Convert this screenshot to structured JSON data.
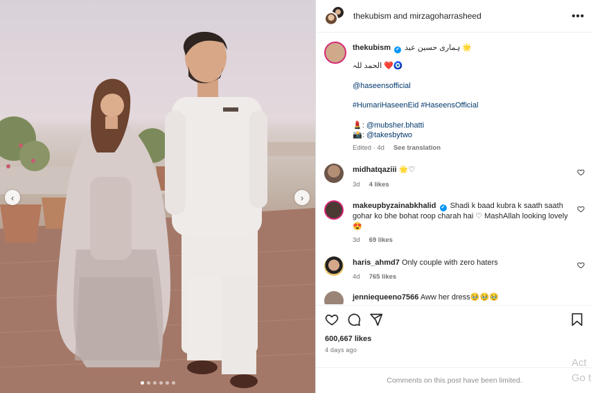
{
  "header": {
    "users": "thekubism and mirzagoharrasheed",
    "more_icon": "•••"
  },
  "caption": {
    "user": "thekubism",
    "verified_glyph": "✔",
    "line1": "ہماری حسین عید 🌟",
    "line2": "الحمد للہ ❤️🧿",
    "line3": "@haseensofficial",
    "line4": "#HumariHaseenEid #HaseensOfficial",
    "line5_prefix": "💄: ",
    "line5_link": "@mubsher.bhatti",
    "line6_prefix": "📸: ",
    "line6_link": "@takesbytwo",
    "edited": "Edited · 4d",
    "see_translation": "See translation"
  },
  "comments": [
    {
      "user": "midhatqaziii",
      "text": "🌟♡",
      "time": "3d",
      "likes": "4 likes"
    },
    {
      "user": "makeupbyzainabkhalid",
      "text": "Shadi k baad kubra k saath saath gohar ko bhe bohat roop charah hai ♡ MashAllah looking lovely 😍",
      "time": "3d",
      "likes": "69 likes"
    },
    {
      "user": "haris_ahmd7",
      "text": "Only couple with zero haters",
      "time": "4d",
      "likes": "765 likes"
    },
    {
      "user": "jenniequeeno7566",
      "text": "Aww her dress🥹🥹🥹"
    }
  ],
  "post": {
    "likes": "600,667 likes",
    "time": "4 days ago",
    "comments_limited": "Comments on this post have been limited."
  },
  "carousel": {
    "prev_glyph": "‹",
    "next_glyph": "›",
    "slide_count": 6,
    "active_slide": 0
  },
  "watermark": {
    "line1": "Act",
    "line2": "Go t"
  }
}
